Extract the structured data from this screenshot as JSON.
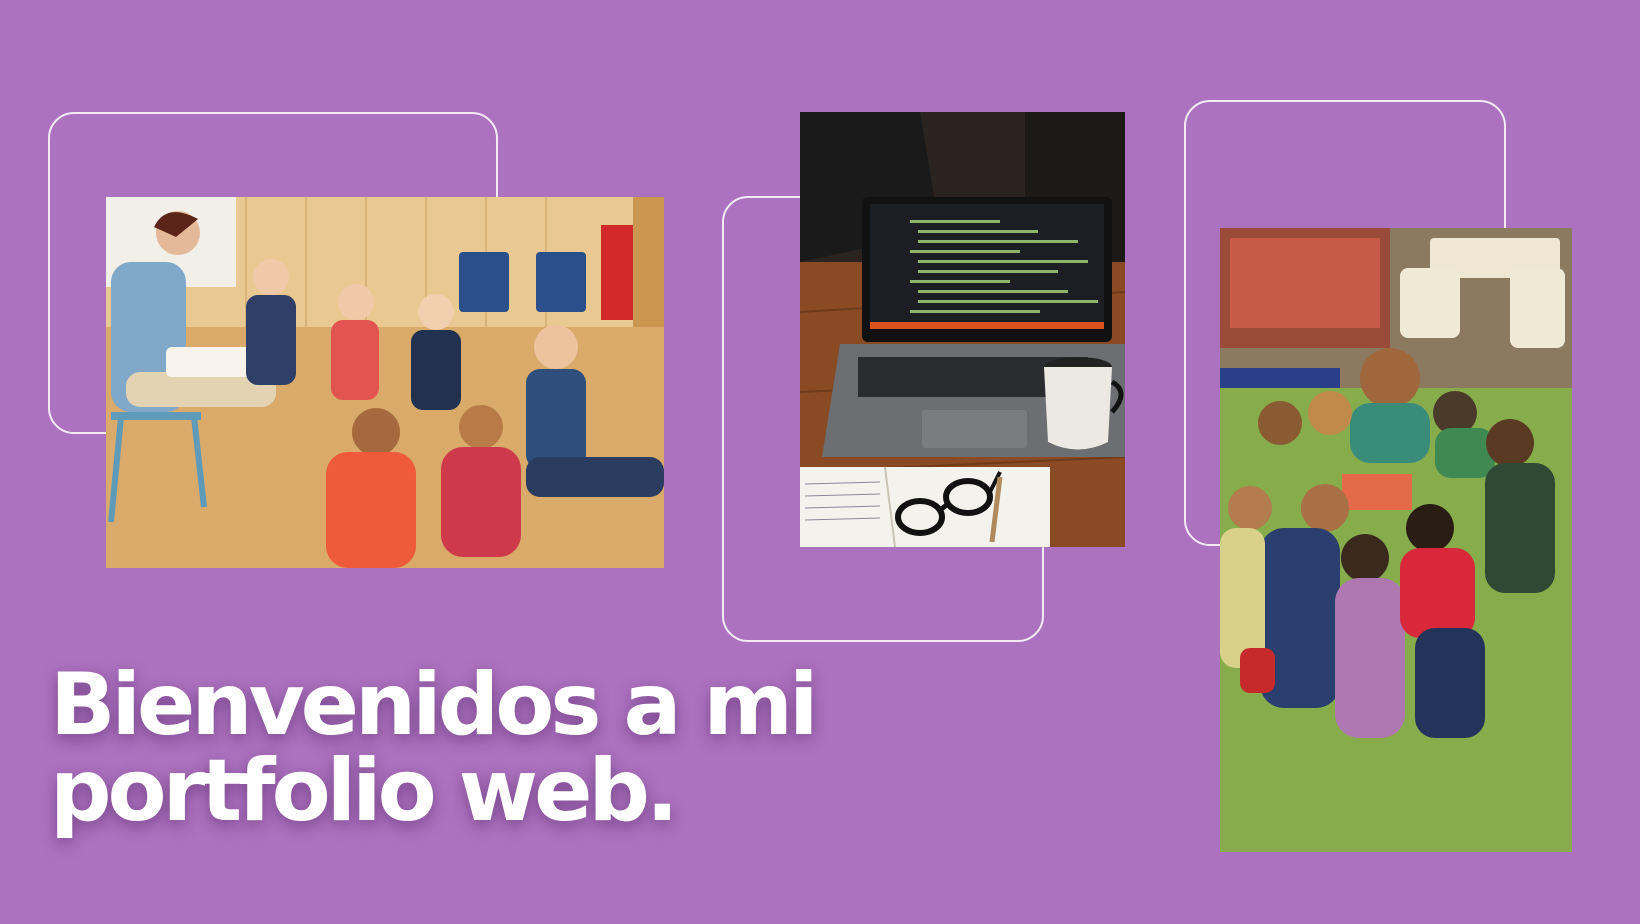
{
  "slide": {
    "background_color": "#ad72bf",
    "frame_color": "#f3eaf6",
    "headline": {
      "line1": "Bienvenidos a mi",
      "line2": "portfolio web."
    }
  },
  "images": [
    {
      "name": "classroom-children-photo",
      "icon": "photo-classroom"
    },
    {
      "name": "laptop-desk-photo",
      "icon": "photo-laptop"
    },
    {
      "name": "kids-floor-activity-photo",
      "icon": "photo-kids-circle"
    }
  ]
}
